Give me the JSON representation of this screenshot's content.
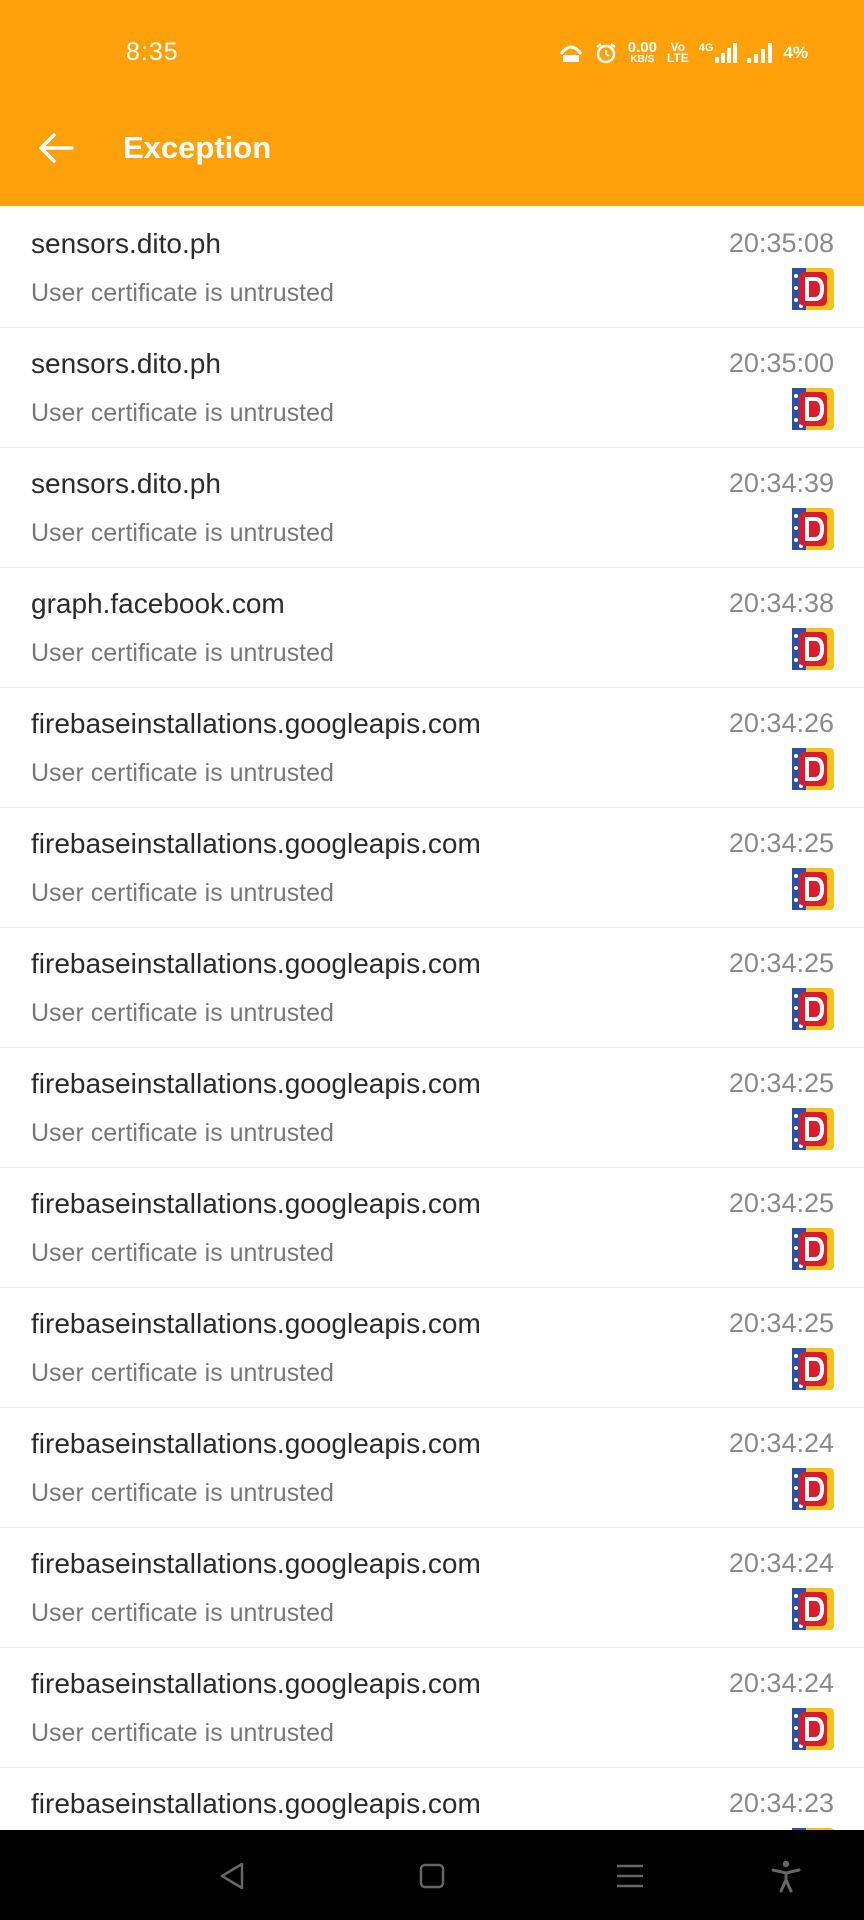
{
  "status": {
    "time": "8:35",
    "speed_value": "0.00",
    "speed_unit": "KB/S",
    "volte_top": "Vo",
    "volte_bottom": "LTE",
    "network": "4G",
    "battery": "4%"
  },
  "appbar": {
    "title": "Exception"
  },
  "rows": [
    {
      "host": "sensors.dito.ph",
      "message": "User certificate is untrusted",
      "time": "20:35:08"
    },
    {
      "host": "sensors.dito.ph",
      "message": "User certificate is untrusted",
      "time": "20:35:00"
    },
    {
      "host": "sensors.dito.ph",
      "message": "User certificate is untrusted",
      "time": "20:34:39"
    },
    {
      "host": "graph.facebook.com",
      "message": "User certificate is untrusted",
      "time": "20:34:38"
    },
    {
      "host": "firebaseinstallations.googleapis.com",
      "message": "User certificate is untrusted",
      "time": "20:34:26"
    },
    {
      "host": "firebaseinstallations.googleapis.com",
      "message": "User certificate is untrusted",
      "time": "20:34:25"
    },
    {
      "host": "firebaseinstallations.googleapis.com",
      "message": "User certificate is untrusted",
      "time": "20:34:25"
    },
    {
      "host": "firebaseinstallations.googleapis.com",
      "message": "User certificate is untrusted",
      "time": "20:34:25"
    },
    {
      "host": "firebaseinstallations.googleapis.com",
      "message": "User certificate is untrusted",
      "time": "20:34:25"
    },
    {
      "host": "firebaseinstallations.googleapis.com",
      "message": "User certificate is untrusted",
      "time": "20:34:25"
    },
    {
      "host": "firebaseinstallations.googleapis.com",
      "message": "User certificate is untrusted",
      "time": "20:34:24"
    },
    {
      "host": "firebaseinstallations.googleapis.com",
      "message": "User certificate is untrusted",
      "time": "20:34:24"
    },
    {
      "host": "firebaseinstallations.googleapis.com",
      "message": "User certificate is untrusted",
      "time": "20:34:24"
    },
    {
      "host": "firebaseinstallations.googleapis.com",
      "message": "",
      "time": "20:34:23"
    }
  ],
  "icons": {
    "row_app": "dito-app-icon",
    "back": "arrow-left-icon",
    "nav": [
      "nav-back-icon",
      "nav-home-icon",
      "nav-menu-icon",
      "accessibility-icon"
    ]
  },
  "colors": {
    "accent": "#FFA10A",
    "app_icon_red": "#D81E2C",
    "app_icon_blue": "#2F4FA2",
    "app_icon_yellow": "#F3C21B"
  }
}
